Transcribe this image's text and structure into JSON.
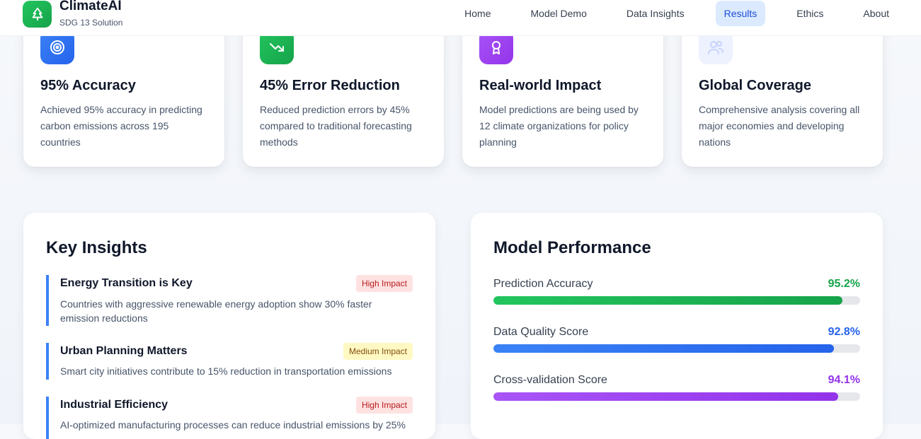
{
  "brand": {
    "name": "ClimateAI",
    "subtitle": "SDG 13 Solution",
    "logo_icon": "tree-icon",
    "accent": "#22c55e"
  },
  "nav": {
    "items": [
      {
        "label": "Home",
        "active": false
      },
      {
        "label": "Model Demo",
        "active": false
      },
      {
        "label": "Data Insights",
        "active": false
      },
      {
        "label": "Results",
        "active": true
      },
      {
        "label": "Ethics",
        "active": false
      },
      {
        "label": "About",
        "active": false
      }
    ],
    "active_color": "#1d4ed8"
  },
  "stats": [
    {
      "icon": "target-icon",
      "color": "#3b82f6",
      "title": "95% Accuracy",
      "description": "Achieved 95% accuracy in predicting carbon emissions across 195 countries"
    },
    {
      "icon": "trending-down-icon",
      "color": "#22c55e",
      "title": "45% Error Reduction",
      "description": "Reduced prediction errors by 45% compared to traditional forecasting methods"
    },
    {
      "icon": "award-icon",
      "color": "#a855f7",
      "title": "Real-world Impact",
      "description": "Model predictions are being used by 12 climate organizations for policy planning"
    },
    {
      "icon": "users-icon",
      "color": "#e0e7ff",
      "title": "Global Coverage",
      "description": "Comprehensive analysis covering all major economies and developing nations"
    }
  ],
  "insights": {
    "title": "Key Insights",
    "items": [
      {
        "title": "Energy Transition is Key",
        "badge": "High Impact",
        "level": "high",
        "description": "Countries with aggressive renewable energy adoption show 30% faster emission reductions"
      },
      {
        "title": "Urban Planning Matters",
        "badge": "Medium Impact",
        "level": "medium",
        "description": "Smart city initiatives contribute to 15% reduction in transportation emissions"
      },
      {
        "title": "Industrial Efficiency",
        "badge": "High Impact",
        "level": "high",
        "description": "AI-optimized manufacturing processes can reduce industrial emissions by 25%"
      }
    ]
  },
  "performance": {
    "title": "Model Performance",
    "metrics": [
      {
        "label": "Prediction Accuracy",
        "value": "95.2%",
        "fraction": 0.952,
        "color": "#16a34a",
        "bar_from": "#22c55e",
        "bar_to": "#16a34a"
      },
      {
        "label": "Data Quality Score",
        "value": "92.8%",
        "fraction": 0.928,
        "color": "#2563eb",
        "bar_from": "#3b82f6",
        "bar_to": "#2563eb"
      },
      {
        "label": "Cross-validation Score",
        "value": "94.1%",
        "fraction": 0.941,
        "color": "#9333ea",
        "bar_from": "#a855f7",
        "bar_to": "#9333ea"
      }
    ]
  }
}
